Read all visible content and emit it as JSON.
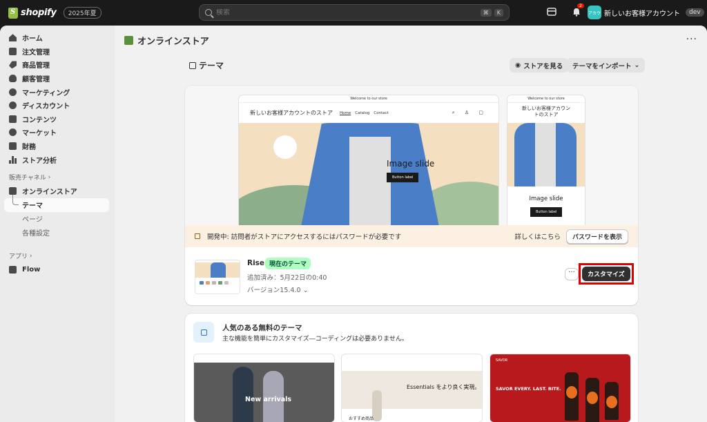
{
  "topbar": {
    "brand": "shopify",
    "edition": "2025年夏",
    "search_placeholder": "検索",
    "shortcut_keys": [
      "⌘",
      "K"
    ],
    "notification_count": "2",
    "account_avatar": "アカウ",
    "account_name": "新しいお客様アカウントの...",
    "env_badge": "dev"
  },
  "sidebar": {
    "items": [
      {
        "label": "ホーム",
        "icon": "home-icon"
      },
      {
        "label": "注文管理",
        "icon": "inbox-icon"
      },
      {
        "label": "商品管理",
        "icon": "tag-icon"
      },
      {
        "label": "顧客管理",
        "icon": "person-icon"
      },
      {
        "label": "マーケティング",
        "icon": "target-icon"
      },
      {
        "label": "ディスカウント",
        "icon": "discount-icon"
      },
      {
        "label": "コンテンツ",
        "icon": "content-icon"
      },
      {
        "label": "マーケット",
        "icon": "globe-icon"
      },
      {
        "label": "財務",
        "icon": "bank-icon"
      },
      {
        "label": "ストア分析",
        "icon": "chart-icon"
      }
    ],
    "sales_channels_label": "販売チャネル",
    "online_store": "オンラインストア",
    "sub_items": [
      "テーマ",
      "ページ",
      "各種設定"
    ],
    "apps_label": "アプリ",
    "flow": "Flow"
  },
  "main": {
    "header": "オンラインストア",
    "page_title": "テーマ",
    "view_store": "ストアを見る",
    "import_theme": "テーマをインポート",
    "preview": {
      "announcement": "Welcome to our store",
      "store_name": "新しいお客様アカウントのストア",
      "nav": [
        "Home",
        "Catalog",
        "Contact"
      ],
      "hero_text": "Image slide",
      "hero_button": "Button label",
      "mobile_store_name": "新しいお客様アカウントのストア"
    },
    "banner": {
      "text": "開発中: 訪問者がストアにアクセスするにはパスワードが必要です",
      "link": "詳しくはこちら",
      "button": "パスワードを表示"
    },
    "current_theme": {
      "name": "Rise",
      "badge": "現在のテーマ",
      "added": "追加済み：5月22日の0:40",
      "version": "バージョン15.4.0",
      "customize": "カスタマイズ"
    },
    "popular": {
      "title": "人気のある無料のテーマ",
      "subtitle": "主な機能を簡単にカスタマイズ―コーディングは必要ありません。",
      "card1_text": "New arrivals",
      "card2_text": "Essentials をより良く実現。",
      "card2_rec": "おすすめ商品",
      "card3_text": "SAVOR EVERY. LAST. BITE.",
      "card3_brand": "SAVOR"
    }
  },
  "colors": {
    "accent_red": "#e00000",
    "badge_green": "#affebf",
    "banner_bg": "#fcf0e3"
  }
}
